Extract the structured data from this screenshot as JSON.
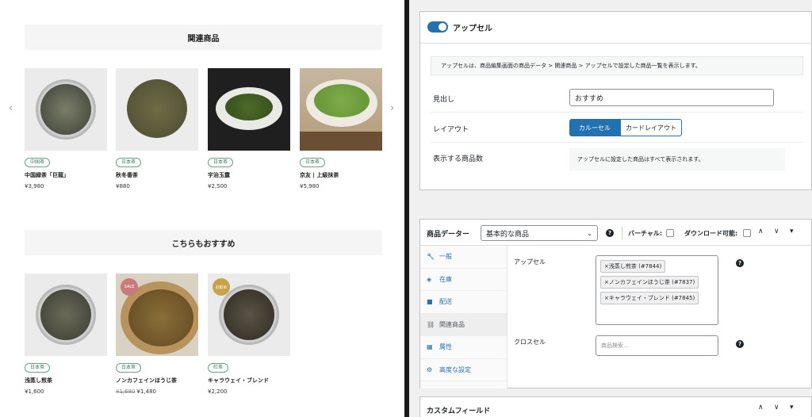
{
  "left": {
    "related": {
      "title": "関連商品",
      "products": [
        {
          "tag": "中国茶",
          "name": "中国緑茶「巨龍」",
          "price": "¥3,980"
        },
        {
          "tag": "日本茶",
          "name": "秋冬番茶",
          "price": "¥880"
        },
        {
          "tag": "日本茶",
          "name": "宇治玉露",
          "price": "¥2,500"
        },
        {
          "tag": "日本茶",
          "name": "京友 | 上級抹茶",
          "price": "¥5,980"
        }
      ]
    },
    "recommend": {
      "title": "こちらもおすすめ",
      "products": [
        {
          "tag": "日本茶",
          "name": "浅蒸し煎茶",
          "price": "¥1,600"
        },
        {
          "tag": "日本茶",
          "name": "ノンカフェインほうじ茶",
          "price_old": "¥1,680",
          "price": "¥1,480",
          "badge": "SALE"
        },
        {
          "tag": "紅茶",
          "name": "キャラウェイ・ブレンド",
          "price": "¥2,200",
          "badge": "お勧め"
        }
      ]
    },
    "arrows": {
      "prev": "‹",
      "next": "›"
    }
  },
  "upsell": {
    "title": "アップセル",
    "toggle_on": true,
    "description": "アップセルは、商品編集画面の商品データ > 関連商品 > アップセルで設定した商品一覧を表示します。",
    "heading_label": "見出し",
    "heading_value": "おすすめ",
    "layout_label": "レイアウト",
    "layout_options": [
      "カルーセル",
      "カードレイアウト"
    ],
    "count_label": "表示する商品数",
    "count_note": "アップセルに設定した商品はすべて表示されます。"
  },
  "product_data": {
    "title": "商品データー",
    "type_select": "基本的な商品",
    "virtual_label": "バーチャル:",
    "download_label": "ダウンロード可能:",
    "tabs": [
      {
        "label": "一般",
        "icon": "wrench-icon"
      },
      {
        "label": "在庫",
        "icon": "tag-icon"
      },
      {
        "label": "配送",
        "icon": "truck-icon"
      },
      {
        "label": "関連商品",
        "icon": "link-icon"
      },
      {
        "label": "属性",
        "icon": "table-icon"
      },
      {
        "label": "高度な設定",
        "icon": "gear-icon"
      }
    ],
    "upsell_label": "アップセル",
    "upsell_items": [
      "×浅蒸し煎茶 (#7844)",
      "×ノンカフェインほうじ茶 (#7837)",
      "×キャラウェイ・ブレンド (#7845)"
    ],
    "crosssell_label": "クロスセル",
    "crosssell_placeholder": "商品検索…"
  },
  "custom_fields": {
    "title": "カスタムフィールド"
  },
  "colors": {
    "accent": "#2271b1",
    "tag_green": "#3a7a5a",
    "sale": "#c97a7a",
    "recommend": "#c8a24a"
  }
}
